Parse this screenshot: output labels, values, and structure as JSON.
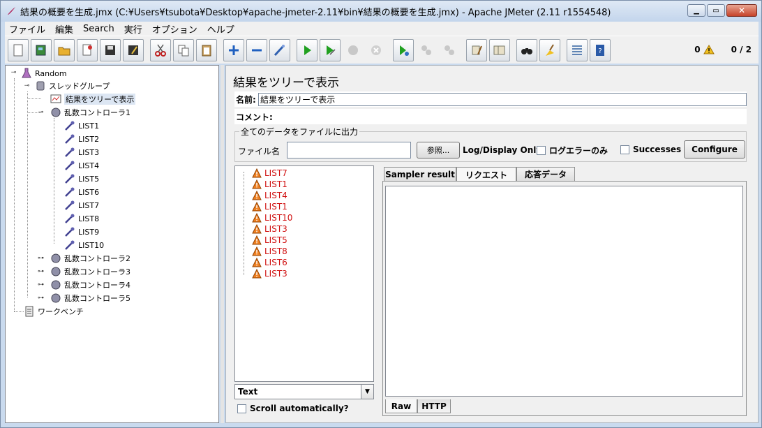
{
  "window": {
    "title": "結果の概要を生成.jmx (C:¥Users¥tsubota¥Desktop¥apache-jmeter-2.11¥bin¥結果の概要を生成.jmx) - Apache JMeter (2.11 r1554548)"
  },
  "menu": [
    "ファイル",
    "編集",
    "Search",
    "実行",
    "オプション",
    "ヘルプ"
  ],
  "toolbar": {
    "warning_count": "0",
    "thread_count": "0 / 2"
  },
  "tree": {
    "root": "Random",
    "thread_group": "スレッドグループ",
    "listener": "結果をツリーで表示",
    "controller1": "乱数コントローラ1",
    "samplers": [
      "LIST1",
      "LIST2",
      "LIST3",
      "LIST4",
      "LIST5",
      "LIST6",
      "LIST7",
      "LIST8",
      "LIST9",
      "LIST10"
    ],
    "controller2": "乱数コントローラ2",
    "controller3": "乱数コントローラ3",
    "controller4": "乱数コントローラ4",
    "controller5": "乱数コントローラ5",
    "workbench": "ワークベンチ"
  },
  "panel": {
    "heading": "結果をツリーで表示",
    "name_label": "名前:",
    "name_value": "結果をツリーで表示",
    "comment_label": "コメント:",
    "file_group_legend": "全てのデータをファイルに出力",
    "file_label": "ファイル名",
    "browse_button": "参照...",
    "log_display_label": "Log/Display Only:",
    "errors_only_label": "ログエラーのみ",
    "successes_label": "Successes",
    "configure_button": "Configure"
  },
  "results": [
    "LIST7",
    "LIST1",
    "LIST4",
    "LIST1",
    "LIST10",
    "LIST3",
    "LIST5",
    "LIST8",
    "LIST6",
    "LIST3"
  ],
  "renderer": {
    "selected": "Text"
  },
  "scroll_label": "Scroll automatically?",
  "tabs": {
    "sampler_result": "Sampler result",
    "request": "リクエスト",
    "response": "応答データ"
  },
  "subtabs": {
    "raw": "Raw",
    "http": "HTTP"
  }
}
